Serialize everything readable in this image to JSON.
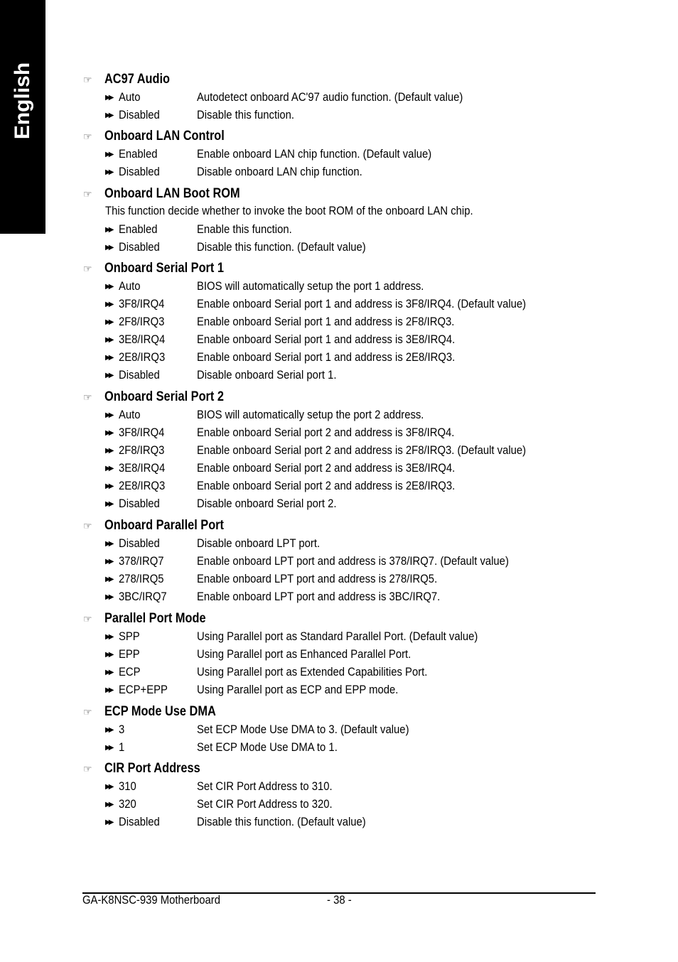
{
  "side_tab": {
    "label": "English"
  },
  "sections": [
    {
      "title": "AC97 Audio",
      "options": [
        {
          "label": "Auto",
          "text": "Autodetect onboard AC'97 audio function. (Default value)"
        },
        {
          "label": "Disabled",
          "text": "Disable this function."
        }
      ]
    },
    {
      "title": "Onboard LAN Control",
      "options": [
        {
          "label": "Enabled",
          "text": "Enable onboard LAN chip function. (Default value)"
        },
        {
          "label": "Disabled",
          "text": "Disable onboard LAN chip function."
        }
      ]
    },
    {
      "title": "Onboard LAN Boot ROM",
      "description": "This function decide whether to invoke the boot ROM of the onboard LAN chip.",
      "options": [
        {
          "label": "Enabled",
          "text": "Enable this function."
        },
        {
          "label": "Disabled",
          "text": "Disable this function. (Default value)"
        }
      ]
    },
    {
      "title": "Onboard Serial Port 1",
      "options": [
        {
          "label": "Auto",
          "text": "BIOS will automatically setup the port 1 address."
        },
        {
          "label": "3F8/IRQ4",
          "text": "Enable onboard Serial port 1 and address is 3F8/IRQ4. (Default value)"
        },
        {
          "label": "2F8/IRQ3",
          "text": "Enable onboard Serial port 1 and address is 2F8/IRQ3."
        },
        {
          "label": "3E8/IRQ4",
          "text": "Enable onboard Serial port 1 and address is 3E8/IRQ4."
        },
        {
          "label": "2E8/IRQ3",
          "text": "Enable onboard Serial port 1 and address is 2E8/IRQ3."
        },
        {
          "label": "Disabled",
          "text": "Disable onboard Serial port 1."
        }
      ]
    },
    {
      "title": "Onboard Serial Port 2",
      "options": [
        {
          "label": "Auto",
          "text": "BIOS will automatically setup the port 2 address."
        },
        {
          "label": "3F8/IRQ4",
          "text": "Enable onboard Serial port 2 and address is 3F8/IRQ4."
        },
        {
          "label": "2F8/IRQ3",
          "text": "Enable onboard Serial port 2 and address is 2F8/IRQ3. (Default value)"
        },
        {
          "label": "3E8/IRQ4",
          "text": "Enable onboard Serial port 2 and address is 3E8/IRQ4."
        },
        {
          "label": "2E8/IRQ3",
          "text": "Enable onboard Serial port 2 and address is 2E8/IRQ3."
        },
        {
          "label": "Disabled",
          "text": "Disable onboard Serial port 2."
        }
      ]
    },
    {
      "title": "Onboard Parallel Port",
      "options": [
        {
          "label": "Disabled",
          "text": "Disable onboard LPT port."
        },
        {
          "label": "378/IRQ7",
          "text": "Enable onboard LPT port and address is 378/IRQ7. (Default value)"
        },
        {
          "label": "278/IRQ5",
          "text": "Enable onboard LPT port and address is 278/IRQ5."
        },
        {
          "label": "3BC/IRQ7",
          "text": "Enable onboard LPT port and address is 3BC/IRQ7."
        }
      ]
    },
    {
      "title": "Parallel Port Mode",
      "options": [
        {
          "label": "SPP",
          "text": "Using Parallel port as Standard Parallel Port. (Default value)"
        },
        {
          "label": "EPP",
          "text": "Using Parallel port as Enhanced Parallel Port."
        },
        {
          "label": "ECP",
          "text": "Using Parallel port as Extended Capabilities Port."
        },
        {
          "label": "ECP+EPP",
          "text": "Using Parallel port as ECP and EPP mode."
        }
      ]
    },
    {
      "title": "ECP Mode Use DMA",
      "options": [
        {
          "label": "3",
          "text": "Set ECP Mode Use DMA to 3. (Default value)"
        },
        {
          "label": "1",
          "text": "Set ECP Mode Use DMA to 1."
        }
      ]
    },
    {
      "title": "CIR Port Address",
      "options": [
        {
          "label": "310",
          "text": "Set CIR Port Address to 310."
        },
        {
          "label": "320",
          "text": "Set CIR Port Address to 320."
        },
        {
          "label": "Disabled",
          "text": "Disable this function. (Default value)"
        }
      ]
    }
  ],
  "icons": {
    "section_bullet": "pointing-hand-icon",
    "option_bullet": "double-arrow-icon"
  },
  "footer": {
    "product": "GA-K8NSC-939 Motherboard",
    "page": "- 38 -"
  }
}
